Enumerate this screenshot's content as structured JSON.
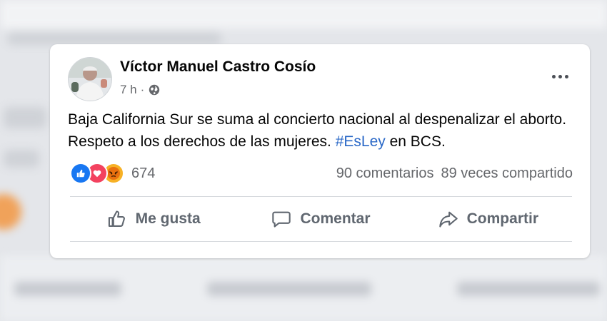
{
  "post": {
    "author": "Víctor Manuel Castro Cosío",
    "time": "7 h",
    "separator": "·",
    "text_before": "Baja California Sur se suma al concierto nacional al despenalizar el aborto. Respeto a los derechos de las mujeres. ",
    "hashtag": "#EsLey",
    "text_after": " en BCS.",
    "reactions": {
      "icons": [
        "like-icon",
        "love-icon",
        "angry-icon"
      ],
      "count": "674"
    },
    "comments": "90 comentarios",
    "shares": "89 veces compartido",
    "actions": {
      "like": "Me gusta",
      "comment": "Comentar",
      "share": "Compartir"
    }
  },
  "colors": {
    "hashtag": "#2a68c7",
    "like": "#1877f2",
    "love": "#f3425f",
    "angry": "#f7b125"
  }
}
